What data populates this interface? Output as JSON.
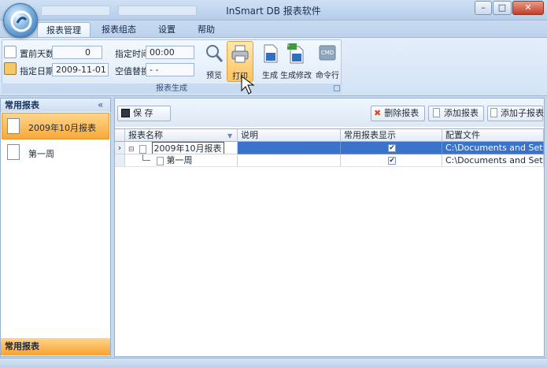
{
  "window": {
    "title": "InSmart DB 报表软件",
    "minimize": "–",
    "maximize": "□",
    "close": "✕"
  },
  "tabs": [
    {
      "label": "报表管理",
      "active": true
    },
    {
      "label": "报表组态"
    },
    {
      "label": "设置"
    },
    {
      "label": "帮助"
    }
  ],
  "ribbon": {
    "fields": {
      "days_before_label": "置前天数",
      "days_before_value": "0",
      "date_label": "指定日期",
      "date_value": "2009-11-01",
      "time_label": "指定时间",
      "time_value": "00:00",
      "null_replace_label": "空值替换",
      "null_replace_value": "- -"
    },
    "buttons": {
      "preview": "预览",
      "print": "打印",
      "generate": "生成",
      "generate_modify": "生成修改",
      "command": "命令行"
    },
    "group_label": "报表生成",
    "cmd_badge": "CMD",
    "xls_badge": "XLS"
  },
  "left_panel": {
    "title": "常用报表",
    "collapse": "«",
    "items": [
      {
        "label": "2009年10月报表",
        "selected": true
      },
      {
        "label": "第一周"
      }
    ],
    "footer": "常用报表"
  },
  "toolbar": {
    "save": "保 存",
    "delete": "删除报表",
    "add": "添加报表",
    "add_child": "添加子报表"
  },
  "grid": {
    "columns": [
      "报表名称",
      "说明",
      "常用报表显示",
      "配置文件"
    ],
    "rows": [
      {
        "name": "2009年10月报表",
        "desc": "",
        "checked": true,
        "config": "C:\\Documents and Setting..."
      },
      {
        "name": "第一周",
        "desc": "",
        "checked": true,
        "config": "C:\\Documents and Setting..."
      }
    ]
  },
  "colors": {
    "accent": "#3a73c9",
    "selected": "#f7a93a",
    "ribbon": "#d3e3f6"
  }
}
